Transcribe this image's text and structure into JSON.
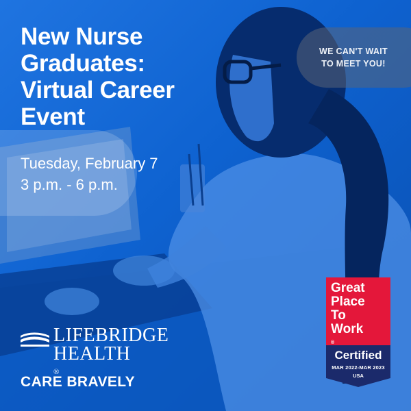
{
  "event": {
    "title_lines": [
      "New Nurse",
      "Graduates:",
      "Virtual Career",
      "Event"
    ],
    "date": "Tuesday, February 7",
    "time": "3 p.m. - 6 p.m."
  },
  "callout": {
    "lines": [
      "WE CAN'T WAIT",
      "TO MEET YOU!"
    ]
  },
  "brand": {
    "name_lines": [
      "LIFEBRIDGE",
      "HEALTH"
    ],
    "registered": "®",
    "tagline": "CARE BRAVELY"
  },
  "badge": {
    "lines": [
      "Great",
      "Place",
      "To",
      "Work"
    ],
    "registered": "®",
    "certified": "Certified",
    "dates": "MAR 2022-MAR 2023",
    "country": "USA",
    "colors": {
      "red": "#e4173a",
      "navy": "#1b2a6b"
    }
  },
  "colors": {
    "background": "#0e62d0",
    "text": "#ffffff"
  }
}
